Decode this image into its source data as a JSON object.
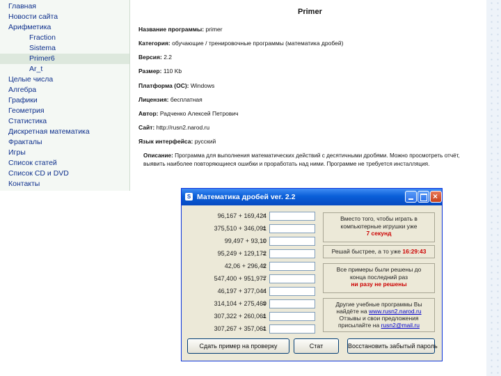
{
  "nav": {
    "items": [
      {
        "label": "Главная",
        "sub": false
      },
      {
        "label": "Новости сайта",
        "sub": false
      },
      {
        "label": "Арифметика",
        "sub": false
      },
      {
        "label": "Fraction",
        "sub": true
      },
      {
        "label": "Sistema",
        "sub": true
      },
      {
        "label": "Primer6",
        "sub": true
      },
      {
        "label": "Ar_t",
        "sub": true
      },
      {
        "label": "Целые числа",
        "sub": false
      },
      {
        "label": "Алгебра",
        "sub": false
      },
      {
        "label": "Графики",
        "sub": false
      },
      {
        "label": "Геометрия",
        "sub": false
      },
      {
        "label": "Статистика",
        "sub": false
      },
      {
        "label": "Дискретная математика",
        "sub": false
      },
      {
        "label": "Фракталы",
        "sub": false
      },
      {
        "label": "Игры",
        "sub": false
      },
      {
        "label": "Список статей",
        "sub": false
      },
      {
        "label": "Список CD и DVD",
        "sub": false
      },
      {
        "label": "Контакты",
        "sub": false
      }
    ]
  },
  "program": {
    "title": "Primer",
    "fields": [
      {
        "label": "Название программы:",
        "value": "primer"
      },
      {
        "label": "Категория:",
        "value": "обучающие / тренировочные программы (математика дробей)"
      },
      {
        "label": "Версия:",
        "value": "2.2"
      },
      {
        "label": "Размер:",
        "value": "110 Kb"
      },
      {
        "label": "Платформа (ОС):",
        "value": "Windows"
      },
      {
        "label": "Лицензия:",
        "value": "бесплатная"
      },
      {
        "label": "Автор:",
        "value": "Радченко Алексей Петрович"
      },
      {
        "label": "Сайт:",
        "value": "http://rusn2.narod.ru"
      },
      {
        "label": "Язык интерфейса:",
        "value": "русский"
      }
    ],
    "description_label": "Описание:",
    "description": "Программа для выполнения математических действий с десятичными дробями. Можно просмотреть отчёт, выявить наиболее повторяющиеся ошибки и проработать над ними. Программе не требуется инсталляция."
  },
  "dialog": {
    "title": "Математика дробей ver. 2.2",
    "app_icon": "S",
    "examples": [
      "96,167 + 169,424",
      "375,510 + 346,091",
      "99,497 + 93,10",
      "95,249 + 129,172",
      "42,06 + 296,42",
      "547,400 + 951,977",
      "46,197 + 377,044",
      "314,104 + 275,469",
      "307,322 + 260,061",
      "307,267 + 357,061"
    ],
    "eq_sign": "=",
    "panel1": {
      "line1": "Вместо того, чтобы играть в",
      "line2": "компьютерные игрушки уже",
      "highlight": "7 секунд"
    },
    "panel2": {
      "label": "Решай быстрее, а то уже",
      "time": "16:29:43"
    },
    "panel3": {
      "line1": "Все примеры были решены до",
      "line2": "конца последний раз",
      "highlight": "ни разу не решены"
    },
    "panel4": {
      "line1": "Другие учебные программы Вы",
      "line2": "найдёте на",
      "link1": "www.rusn2.narod.ru",
      "line3": "Отзывы и свои предложения",
      "line4": "присылайте на",
      "link2": "rusn2@mail.ru"
    },
    "buttons": {
      "check": "Сдать пример на проверку",
      "stat": "Стат",
      "restore": "Восстановить забытый пароль"
    }
  },
  "colors": {
    "nav_link": "#0d2f8c",
    "titlebar": "#0a5fd8",
    "highlight": "#cc0000"
  }
}
